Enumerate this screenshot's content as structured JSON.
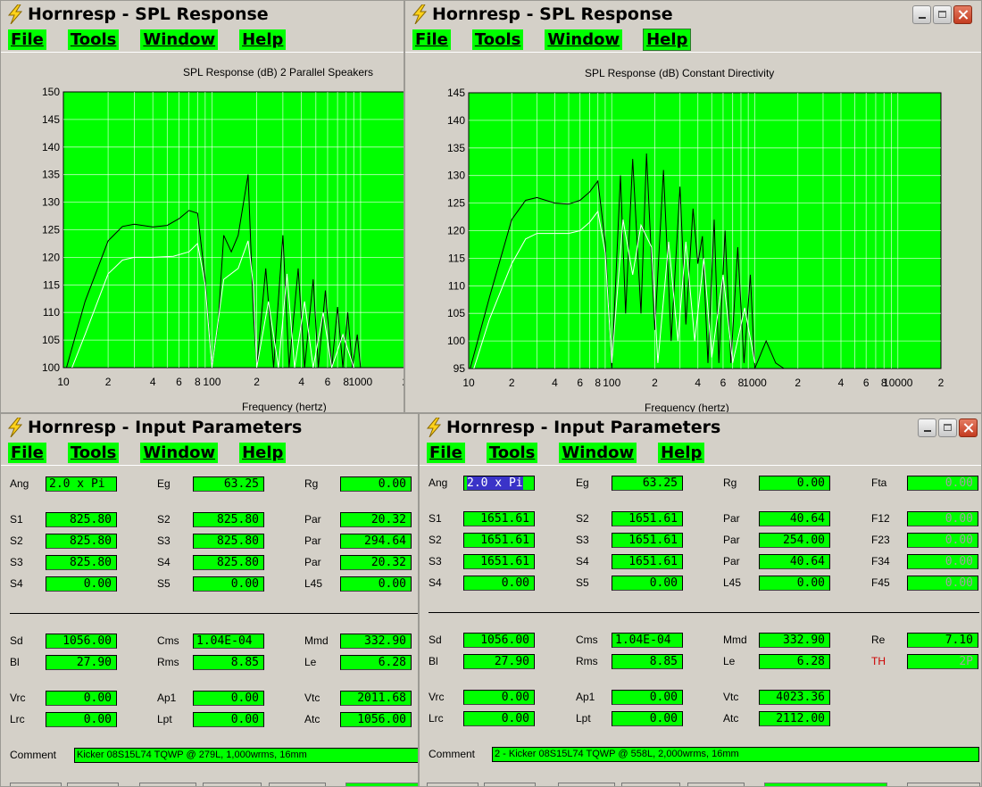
{
  "menu": [
    "File",
    "Tools",
    "Window",
    "Help"
  ],
  "spl1": {
    "title": "Hornresp - SPL Response",
    "chart_title": "SPL Response (dB)   2 Parallel Speakers",
    "xlabel": "Frequency (hertz)"
  },
  "spl2": {
    "title": "Hornresp - SPL Response",
    "chart_title": "SPL Response (dB)   Constant Directivity",
    "xlabel": "Frequency (hertz)"
  },
  "chart_data": [
    {
      "type": "line",
      "title": "SPL Response (dB)   2 Parallel Speakers",
      "xlabel": "Frequency (hertz)",
      "ylabel": "",
      "xscale": "log",
      "xlim": [
        10,
        2000
      ],
      "ylim": [
        100,
        150
      ],
      "yticks": [
        100,
        105,
        110,
        115,
        120,
        125,
        130,
        135,
        140,
        145,
        150
      ],
      "xtick_labels": [
        "10",
        "2",
        "4",
        "6",
        "8",
        "100",
        "2",
        "4",
        "6",
        "8",
        "1000",
        "2"
      ],
      "background": "#00ff00",
      "grid": true,
      "series": [
        {
          "color": "#000000",
          "points": [
            [
              10,
              98
            ],
            [
              14,
              112
            ],
            [
              20,
              123
            ],
            [
              25,
              125.6
            ],
            [
              30,
              126
            ],
            [
              40,
              125.5
            ],
            [
              50,
              125.8
            ],
            [
              60,
              127
            ],
            [
              70,
              128.5
            ],
            [
              80,
              128
            ],
            [
              90,
              116
            ],
            [
              100,
              100
            ],
            [
              110,
              108
            ],
            [
              120,
              124
            ],
            [
              135,
              121
            ],
            [
              150,
              124
            ],
            [
              175,
              135
            ],
            [
              190,
              110
            ],
            [
              200,
              100
            ],
            [
              230,
              118
            ],
            [
              260,
              100
            ],
            [
              300,
              124
            ],
            [
              330,
              100
            ],
            [
              380,
              118
            ],
            [
              420,
              100
            ],
            [
              480,
              116
            ],
            [
              520,
              100
            ],
            [
              580,
              114
            ],
            [
              640,
              100
            ],
            [
              700,
              111
            ],
            [
              760,
              100
            ],
            [
              820,
              110
            ],
            [
              880,
              100
            ],
            [
              950,
              106
            ],
            [
              1000,
              100
            ]
          ]
        },
        {
          "color": "#ffffff",
          "points": [
            [
              10,
              96
            ],
            [
              14,
              106
            ],
            [
              20,
              117
            ],
            [
              25,
              119.5
            ],
            [
              30,
              120
            ],
            [
              40,
              120
            ],
            [
              55,
              120.2
            ],
            [
              70,
              121
            ],
            [
              80,
              122.5
            ],
            [
              90,
              115
            ],
            [
              100,
              100
            ],
            [
              120,
              116
            ],
            [
              150,
              118
            ],
            [
              175,
              123
            ],
            [
              190,
              115
            ],
            [
              200,
              100
            ],
            [
              240,
              112
            ],
            [
              280,
              100
            ],
            [
              320,
              117
            ],
            [
              360,
              100
            ],
            [
              420,
              112
            ],
            [
              480,
              100
            ],
            [
              560,
              110
            ],
            [
              640,
              100
            ],
            [
              760,
              106
            ],
            [
              900,
              100
            ]
          ]
        }
      ]
    },
    {
      "type": "line",
      "title": "SPL Response (dB)   Constant Directivity",
      "xlabel": "Frequency (hertz)",
      "ylabel": "",
      "xscale": "log",
      "xlim": [
        10,
        20000
      ],
      "ylim": [
        95,
        145
      ],
      "yticks": [
        95,
        100,
        105,
        110,
        115,
        120,
        125,
        130,
        135,
        140,
        145
      ],
      "xtick_labels": [
        "10",
        "2",
        "4",
        "6",
        "8",
        "100",
        "2",
        "4",
        "6",
        "8",
        "1000",
        "2",
        "4",
        "6",
        "8",
        "10000",
        "2"
      ],
      "background": "#00ff00",
      "grid": true,
      "series": [
        {
          "color": "#000000",
          "points": [
            [
              10,
              94
            ],
            [
              14,
              108
            ],
            [
              20,
              122
            ],
            [
              25,
              125.5
            ],
            [
              30,
              126
            ],
            [
              40,
              125
            ],
            [
              50,
              124.8
            ],
            [
              60,
              125.5
            ],
            [
              70,
              127
            ],
            [
              80,
              129
            ],
            [
              90,
              118
            ],
            [
              100,
              95
            ],
            [
              115,
              130
            ],
            [
              125,
              105
            ],
            [
              140,
              133
            ],
            [
              160,
              105
            ],
            [
              175,
              134
            ],
            [
              200,
              102
            ],
            [
              230,
              131
            ],
            [
              260,
              100
            ],
            [
              300,
              128
            ],
            [
              330,
              103
            ],
            [
              370,
              124
            ],
            [
              400,
              114
            ],
            [
              430,
              119
            ],
            [
              470,
              96
            ],
            [
              520,
              122
            ],
            [
              560,
              96
            ],
            [
              620,
              120
            ],
            [
              680,
              96
            ],
            [
              760,
              117
            ],
            [
              840,
              96
            ],
            [
              930,
              112
            ],
            [
              1000,
              95
            ],
            [
              1200,
              100
            ],
            [
              1400,
              96
            ],
            [
              1600,
              95
            ]
          ]
        },
        {
          "color": "#ffffff",
          "points": [
            [
              10,
              92
            ],
            [
              14,
              104
            ],
            [
              20,
              114
            ],
            [
              25,
              118.5
            ],
            [
              30,
              119.5
            ],
            [
              40,
              119.5
            ],
            [
              50,
              119.5
            ],
            [
              60,
              120
            ],
            [
              70,
              121.5
            ],
            [
              80,
              123.5
            ],
            [
              90,
              116
            ],
            [
              100,
              96
            ],
            [
              120,
              122
            ],
            [
              140,
              112
            ],
            [
              160,
              121
            ],
            [
              190,
              117
            ],
            [
              210,
              96
            ],
            [
              250,
              118
            ],
            [
              290,
              100
            ],
            [
              330,
              118
            ],
            [
              380,
              100
            ],
            [
              440,
              115
            ],
            [
              500,
              97
            ],
            [
              600,
              112
            ],
            [
              700,
              96
            ],
            [
              850,
              106
            ],
            [
              1000,
              96
            ]
          ]
        }
      ]
    }
  ],
  "ip1": {
    "title": "Hornresp - Input Parameters",
    "rows": [
      [
        {
          "l": "Ang",
          "v": "2.0 x Pi",
          "al": "left"
        },
        {
          "l": "Eg",
          "v": "63.25"
        },
        {
          "l": "Rg",
          "v": "0.00"
        }
      ],
      [
        {
          "l": "S1",
          "v": "825.80"
        },
        {
          "l": "S2",
          "v": "825.80"
        },
        {
          "l": "Par",
          "v": "20.32"
        }
      ],
      [
        {
          "l": "S2",
          "v": "825.80"
        },
        {
          "l": "S3",
          "v": "825.80"
        },
        {
          "l": "Par",
          "v": "294.64"
        }
      ],
      [
        {
          "l": "S3",
          "v": "825.80"
        },
        {
          "l": "S4",
          "v": "825.80"
        },
        {
          "l": "Par",
          "v": "20.32"
        }
      ],
      [
        {
          "l": "S4",
          "v": "0.00"
        },
        {
          "l": "S5",
          "v": "0.00"
        },
        {
          "l": "L45",
          "v": "0.00"
        }
      ],
      [
        {
          "l": "Sd",
          "v": "1056.00"
        },
        {
          "l": "Cms",
          "v": "1.04E-04",
          "al": "left"
        },
        {
          "l": "Mmd",
          "v": "332.90"
        }
      ],
      [
        {
          "l": "Bl",
          "v": "27.90"
        },
        {
          "l": "Rms",
          "v": "8.85"
        },
        {
          "l": "Le",
          "v": "6.28"
        }
      ],
      [
        {
          "l": "Vrc",
          "v": "0.00"
        },
        {
          "l": "Ap1",
          "v": "0.00"
        },
        {
          "l": "Vtc",
          "v": "2011.68"
        }
      ],
      [
        {
          "l": "Lrc",
          "v": "0.00"
        },
        {
          "l": "Lpt",
          "v": "0.00"
        },
        {
          "l": "Atc",
          "v": "1056.00"
        }
      ]
    ],
    "comment_label": "Comment",
    "comment": "Kicker 08S15L74 TQWP @ 279L, 1,000wrms, 16mm"
  },
  "ip2": {
    "title": "Hornresp - Input Parameters",
    "rows": [
      [
        {
          "l": "Ang",
          "v": "2.0 x Pi",
          "al": "left",
          "hl": true
        },
        {
          "l": "Eg",
          "v": "63.25"
        },
        {
          "l": "Rg",
          "v": "0.00"
        },
        {
          "l": "Fta",
          "v": "0.00",
          "dim": true
        }
      ],
      [
        {
          "l": "S1",
          "v": "1651.61"
        },
        {
          "l": "S2",
          "v": "1651.61"
        },
        {
          "l": "Par",
          "v": "40.64"
        },
        {
          "l": "F12",
          "v": "0.00",
          "dim": true
        }
      ],
      [
        {
          "l": "S2",
          "v": "1651.61"
        },
        {
          "l": "S3",
          "v": "1651.61"
        },
        {
          "l": "Par",
          "v": "254.00"
        },
        {
          "l": "F23",
          "v": "0.00",
          "dim": true
        }
      ],
      [
        {
          "l": "S3",
          "v": "1651.61"
        },
        {
          "l": "S4",
          "v": "1651.61"
        },
        {
          "l": "Par",
          "v": "40.64"
        },
        {
          "l": "F34",
          "v": "0.00",
          "dim": true
        }
      ],
      [
        {
          "l": "S4",
          "v": "0.00"
        },
        {
          "l": "S5",
          "v": "0.00"
        },
        {
          "l": "L45",
          "v": "0.00"
        },
        {
          "l": "F45",
          "v": "0.00",
          "dim": true
        }
      ],
      [
        {
          "l": "Sd",
          "v": "1056.00"
        },
        {
          "l": "Cms",
          "v": "1.04E-04",
          "al": "left"
        },
        {
          "l": "Mmd",
          "v": "332.90"
        },
        {
          "l": "Re",
          "v": "7.10"
        }
      ],
      [
        {
          "l": "Bl",
          "v": "27.90"
        },
        {
          "l": "Rms",
          "v": "8.85"
        },
        {
          "l": "Le",
          "v": "6.28"
        },
        {
          "l": "TH",
          "v": "2P",
          "dim": true,
          "red": true
        }
      ],
      [
        {
          "l": "Vrc",
          "v": "0.00"
        },
        {
          "l": "Ap1",
          "v": "0.00"
        },
        {
          "l": "Vtc",
          "v": "4023.36"
        }
      ],
      [
        {
          "l": "Lrc",
          "v": "0.00"
        },
        {
          "l": "Lpt",
          "v": "0.00"
        },
        {
          "l": "Atc",
          "v": "2112.00"
        }
      ]
    ],
    "comment_label": "Comment",
    "comment": "2 - Kicker 08S15L74 TQWP @ 558L, 2,000wrms, 16mm"
  },
  "colors": {
    "plot_bg": "#00ff00",
    "field_bg": "#00ff00",
    "window_bg": "#d4d0c8",
    "highlight": "#3a33c8"
  },
  "icons": [
    "lightning-icon",
    "minimize-icon",
    "maximize-icon",
    "close-icon"
  ]
}
